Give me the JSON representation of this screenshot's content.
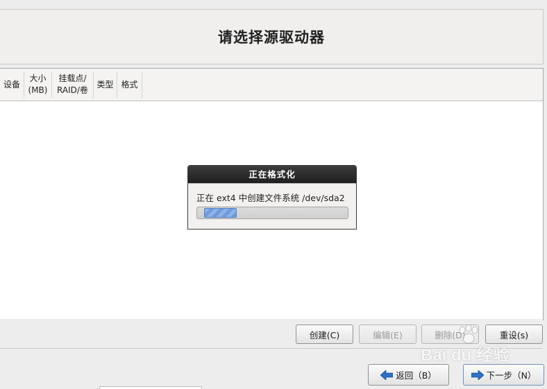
{
  "header": {
    "title": "请选择源驱动器"
  },
  "table": {
    "columns": [
      {
        "label": "设备"
      },
      {
        "label": "大小\n(MB)"
      },
      {
        "label": "挂载点/\nRAID/卷"
      },
      {
        "label": "类型"
      },
      {
        "label": "格式"
      }
    ]
  },
  "dialog": {
    "title": "正在格式化",
    "message": "正在 ext4 中创建文件系统 /dev/sda2",
    "progress": 0.22
  },
  "actions": {
    "create_label": "创建(C)",
    "edit_label": "编辑(E)",
    "delete_label": "删除(D)",
    "reset_label": "重设(s)"
  },
  "nav": {
    "back_label": "返回（B）",
    "next_label": "下一步（N）"
  },
  "watermark": {
    "text": "Bai du 经验"
  },
  "colors": {
    "accent_blue": "#2f6fc6",
    "titlebar": "#2a2a2a",
    "progress_fill": "#7ea6e0"
  }
}
